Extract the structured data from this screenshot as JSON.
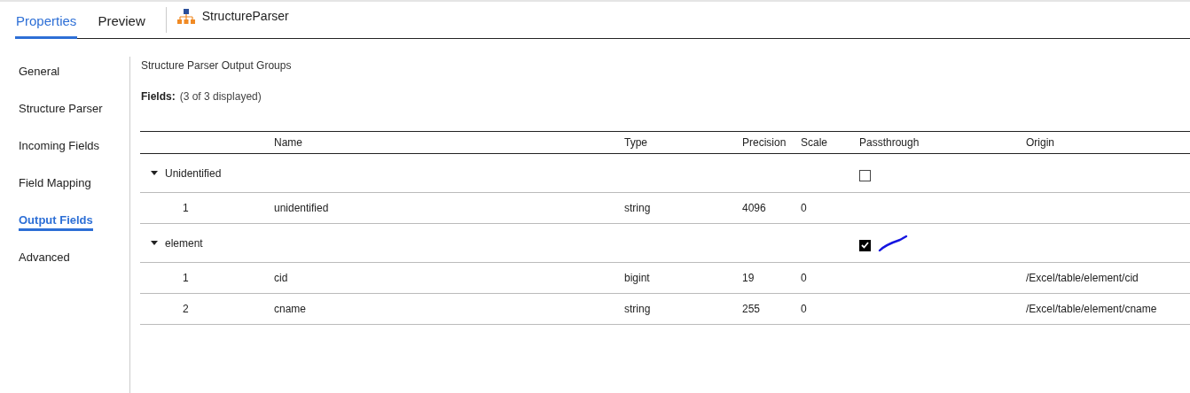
{
  "tabs": [
    {
      "label": "Properties",
      "selected": true
    },
    {
      "label": "Preview",
      "selected": false
    }
  ],
  "object_title": "StructureParser",
  "sidebar": {
    "items": [
      {
        "label": "General",
        "selected": false
      },
      {
        "label": "Structure Parser",
        "selected": false
      },
      {
        "label": "Incoming Fields",
        "selected": false
      },
      {
        "label": "Field Mapping",
        "selected": false
      },
      {
        "label": "Output Fields",
        "selected": true
      },
      {
        "label": "Advanced",
        "selected": false
      }
    ]
  },
  "section_title": "Structure Parser Output Groups",
  "fields_label": "Fields:",
  "fields_count": "(3 of 3 displayed)",
  "table": {
    "columns": [
      "Name",
      "Type",
      "Precision",
      "Scale",
      "Passthrough",
      "Origin"
    ],
    "groups": [
      {
        "name": "Unidentified",
        "expanded": true,
        "passthrough": false,
        "rows": [
          {
            "index": "1",
            "name": "unidentified",
            "type": "string",
            "precision": "4096",
            "scale": "0"
          }
        ]
      },
      {
        "name": "element",
        "expanded": true,
        "passthrough": true,
        "rows": [
          {
            "index": "1",
            "name": "cid",
            "type": "bigint",
            "precision": "19",
            "scale": "0",
            "origin": "/Excel/table/element/cid"
          },
          {
            "index": "2",
            "name": "cname",
            "type": "string",
            "precision": "255",
            "scale": "0",
            "origin": "/Excel/table/element/cname"
          }
        ]
      }
    ]
  }
}
